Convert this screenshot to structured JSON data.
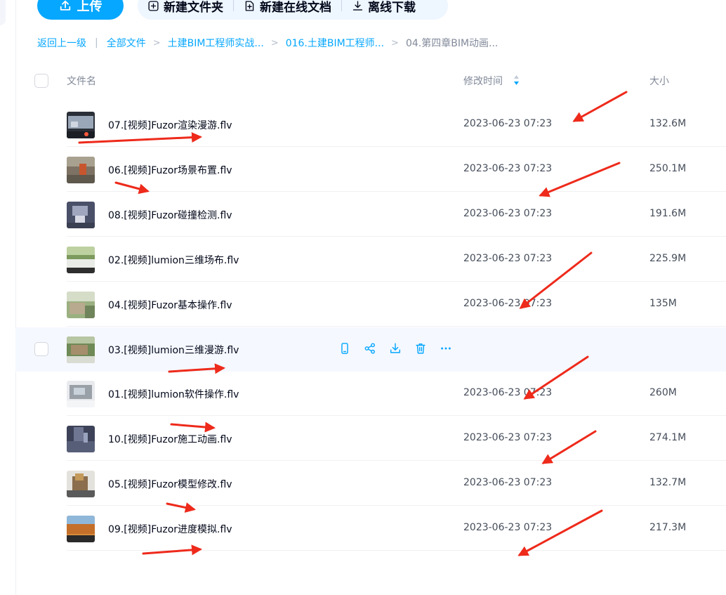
{
  "toolbar": {
    "upload_label": "上传",
    "new_folder_label": "新建文件夹",
    "new_doc_label": "新建在线文档",
    "offline_download_label": "离线下载"
  },
  "breadcrumb": {
    "back": "返回上一级",
    "all_files": "全部文件",
    "level1": "土建BIM工程师实战...",
    "level2": "016.土建BIM工程师...",
    "current": "04.第四章BIM动画..."
  },
  "table": {
    "col_name": "文件名",
    "col_modified": "修改时间",
    "col_size": "大小"
  },
  "files": [
    {
      "name": "07.[视频]Fuzor渲染漫游.flv",
      "date": "2023-06-23 07:23",
      "size": "132.6M"
    },
    {
      "name": "06.[视频]Fuzor场景布置.flv",
      "date": "2023-06-23 07:23",
      "size": "250.1M"
    },
    {
      "name": "08.[视频]Fuzor碰撞检测.flv",
      "date": "2023-06-23 07:23",
      "size": "191.6M"
    },
    {
      "name": "02.[视频]lumion三维场布.flv",
      "date": "2023-06-23 07:23",
      "size": "225.9M"
    },
    {
      "name": "04.[视频]Fuzor基本操作.flv",
      "date": "2023-06-23 07:23",
      "size": "135M"
    },
    {
      "name": "03.[视频]lumion三维漫游.flv",
      "date": "",
      "size": ""
    },
    {
      "name": "01.[视频]lumion软件操作.flv",
      "date": "2023-06-23 07:23",
      "size": "260M"
    },
    {
      "name": "10.[视频]Fuzor施工动画.flv",
      "date": "2023-06-23 07:23",
      "size": "274.1M"
    },
    {
      "name": "05.[视频]Fuzor模型修改.flv",
      "date": "2023-06-23 07:23",
      "size": "132.7M"
    },
    {
      "name": "09.[视频]Fuzor进度模拟.flv",
      "date": "2023-06-23 07:23",
      "size": "217.3M"
    }
  ],
  "hover_row_actions": [
    "phone-icon",
    "share-icon",
    "download-icon",
    "delete-icon",
    "more-icon"
  ],
  "colors": {
    "accent": "#06a7ff",
    "toolbar_bg": "#eef6ff",
    "hover_row_bg": "#f5f8ff",
    "annotation_arrow": "#ee2a1b"
  }
}
